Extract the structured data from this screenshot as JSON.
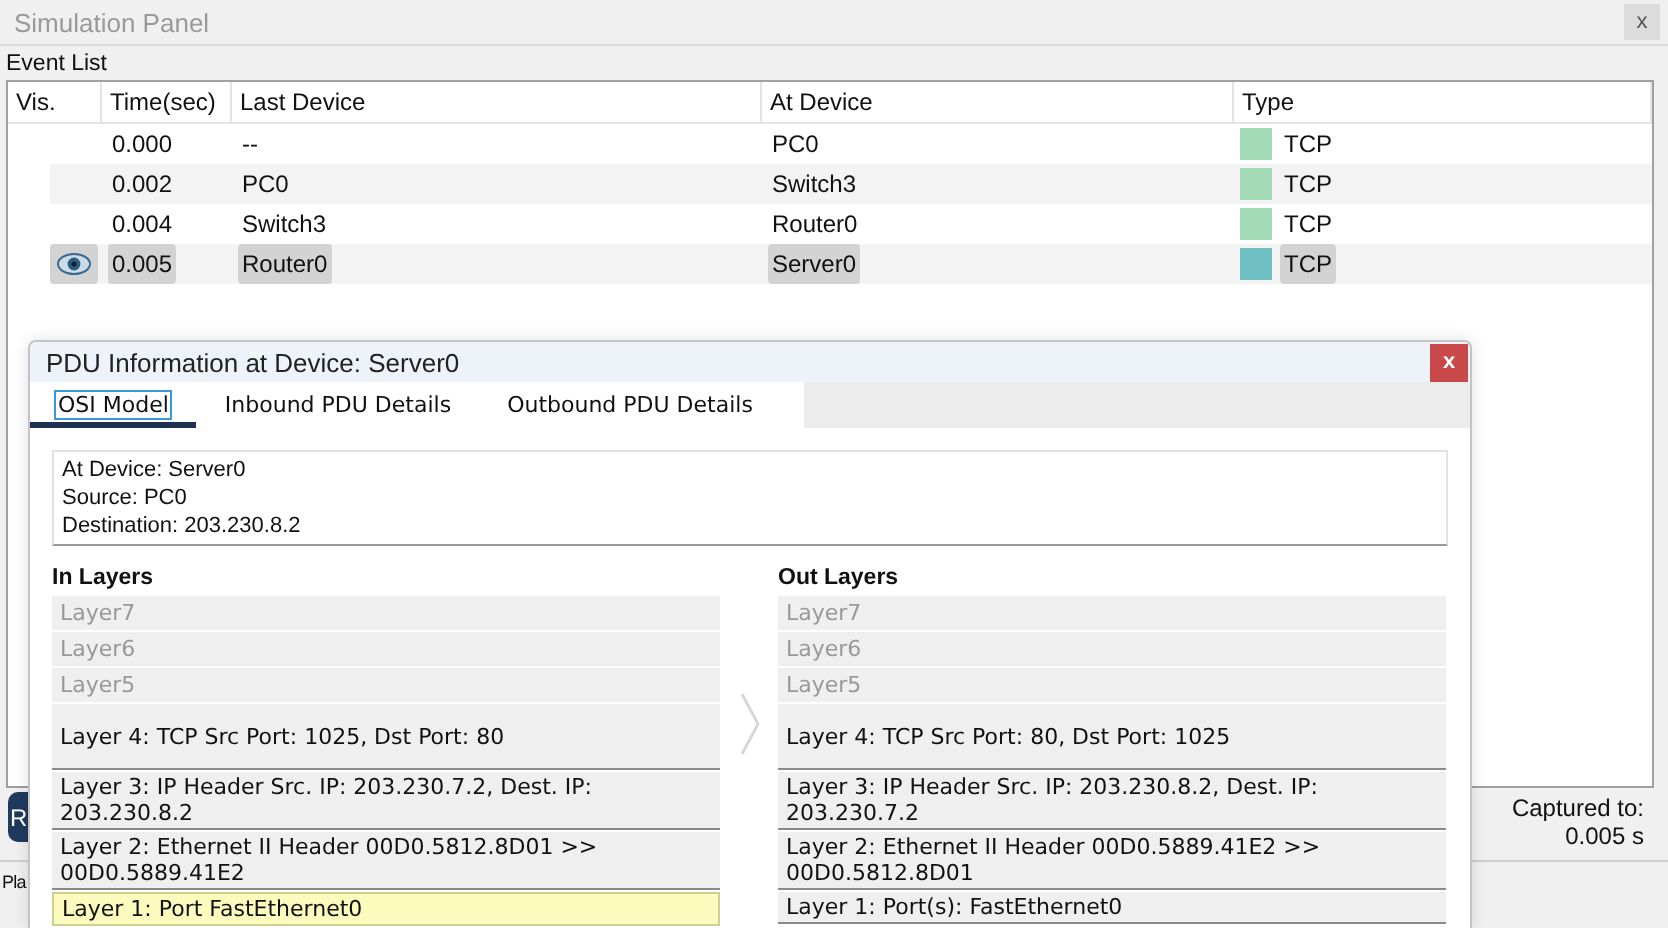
{
  "window": {
    "title": "Simulation Panel",
    "close": "x"
  },
  "event_list": {
    "label": "Event List",
    "columns": [
      "Vis.",
      "Time(sec)",
      "Last Device",
      "At Device",
      "Type"
    ],
    "rows": [
      {
        "time": "0.000",
        "last_device": "--",
        "at_device": "PC0",
        "type": "TCP",
        "color": "#a3dbb7",
        "selected": false
      },
      {
        "time": "0.002",
        "last_device": "PC0",
        "at_device": "Switch3",
        "type": "TCP",
        "color": "#a3dbb7",
        "selected": false
      },
      {
        "time": "0.004",
        "last_device": "Switch3",
        "at_device": "Router0",
        "type": "TCP",
        "color": "#a3dbb7",
        "selected": false
      },
      {
        "time": "0.005",
        "last_device": "Router0",
        "at_device": "Server0",
        "type": "TCP",
        "color": "#6fbfc3",
        "selected": true
      }
    ]
  },
  "side_button": {
    "label": "R"
  },
  "captured": {
    "label": "Captured to:",
    "value": "0.005 s"
  },
  "footer_text": "Pla",
  "pdu": {
    "title": "PDU Information at Device: Server0",
    "close": "x",
    "tabs": [
      {
        "label": "OSI Model",
        "selected": true
      },
      {
        "label": "Inbound PDU Details",
        "selected": false
      },
      {
        "label": "Outbound PDU Details",
        "selected": false
      }
    ],
    "info": [
      "At Device: Server0",
      "Source: PC0",
      "Destination: 203.230.8.2"
    ],
    "in_layers": {
      "title": "In Layers",
      "layers": [
        {
          "text": "Layer7",
          "disabled": true,
          "highlighted": false
        },
        {
          "text": "Layer6",
          "disabled": true,
          "highlighted": false
        },
        {
          "text": "Layer5",
          "disabled": true,
          "highlighted": false
        },
        {
          "text": "Layer 4: TCP Src Port: 1025, Dst Port: 80",
          "disabled": false,
          "highlighted": false
        },
        {
          "text": "Layer 3: IP Header Src. IP: 203.230.7.2, Dest. IP: 203.230.8.2",
          "disabled": false,
          "highlighted": false
        },
        {
          "text": "Layer 2: Ethernet II Header 00D0.5812.8D01 >> 00D0.5889.41E2",
          "disabled": false,
          "highlighted": false
        },
        {
          "text": "Layer 1: Port FastEthernet0",
          "disabled": false,
          "highlighted": true
        }
      ]
    },
    "out_layers": {
      "title": "Out Layers",
      "layers": [
        {
          "text": "Layer7",
          "disabled": true,
          "highlighted": false
        },
        {
          "text": "Layer6",
          "disabled": true,
          "highlighted": false
        },
        {
          "text": "Layer5",
          "disabled": true,
          "highlighted": false
        },
        {
          "text": "Layer 4: TCP Src Port: 80, Dst Port: 1025",
          "disabled": false,
          "highlighted": false
        },
        {
          "text": "Layer 3: IP Header Src. IP: 203.230.8.2, Dest. IP: 203.230.7.2",
          "disabled": false,
          "highlighted": false
        },
        {
          "text": "Layer 2: Ethernet II Header 00D0.5889.41E2 >> 00D0.5812.8D01",
          "disabled": false,
          "highlighted": false
        },
        {
          "text": "Layer 1: Port(s): FastEthernet0",
          "disabled": false,
          "highlighted": false
        }
      ]
    }
  }
}
